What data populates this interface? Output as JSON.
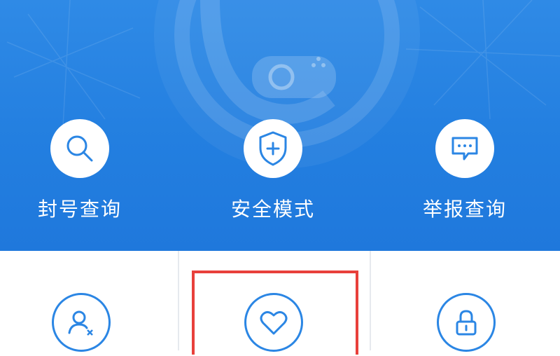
{
  "top_actions": [
    {
      "label": "封号查询",
      "icon": "search-icon"
    },
    {
      "label": "安全模式",
      "icon": "shield-plus-icon"
    },
    {
      "label": "举报查询",
      "icon": "chat-report-icon"
    }
  ],
  "bottom_actions": [
    {
      "icon": "user-remove-icon"
    },
    {
      "icon": "heart-icon",
      "highlighted": true
    },
    {
      "icon": "lock-icon"
    }
  ],
  "colors": {
    "hero_blue": "#2580e0",
    "icon_blue": "#2b86e4",
    "highlight_red": "#e8403b"
  }
}
